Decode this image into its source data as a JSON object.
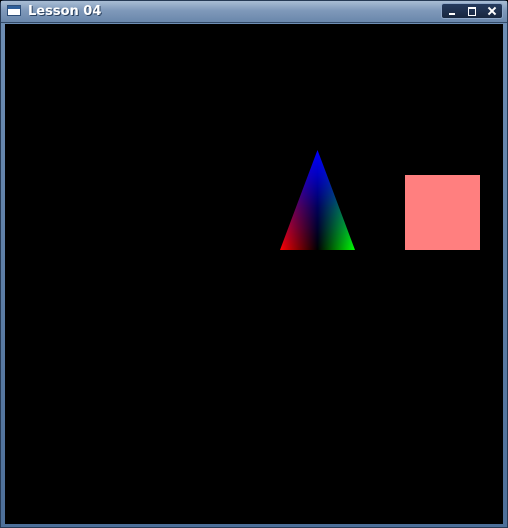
{
  "window": {
    "title": "Lesson 04",
    "controls": {
      "minimize": "minimize",
      "maximize": "maximize",
      "close": "close"
    }
  },
  "scene": {
    "background_color": "#000000",
    "triangle": {
      "top_color": "#0000ff",
      "left_color": "#ff0000",
      "right_color": "#00ff00"
    },
    "square": {
      "color": "#ff7f7f"
    }
  }
}
